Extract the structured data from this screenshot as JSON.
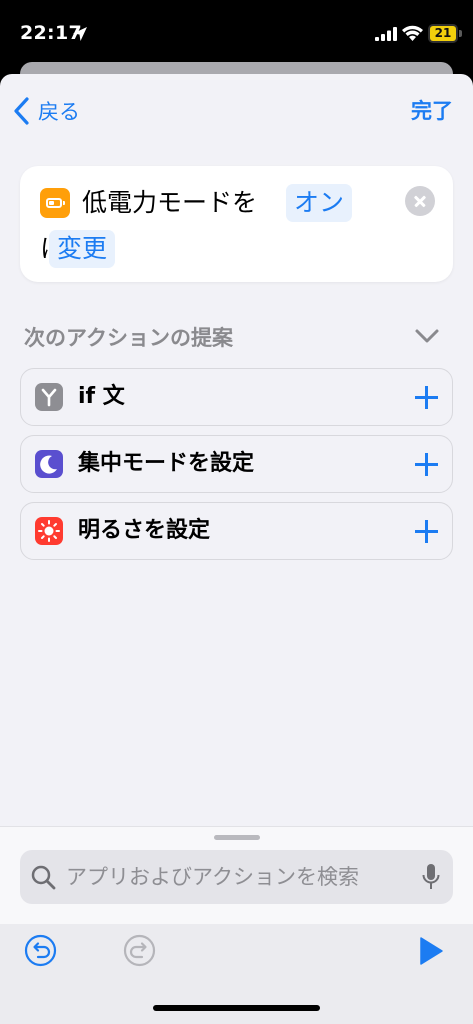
{
  "status_bar": {
    "time": "22:17",
    "battery_level": "21",
    "icons": [
      "location-arrow-icon",
      "cellular-signal-icon",
      "wifi-icon",
      "battery-icon"
    ]
  },
  "nav": {
    "back_label": "戻る",
    "done_label": "完了"
  },
  "action": {
    "icon": "battery-icon",
    "icon_color": "#ff9f0a",
    "title": "低電力モードを",
    "value_token": "オン",
    "connector": "に",
    "mode_token": "変更"
  },
  "suggestions": {
    "header": "次のアクションの提案",
    "items": [
      {
        "label": "if 文",
        "icon": "branch-icon",
        "icon_color": "#8e8e93"
      },
      {
        "label": "集中モードを設定",
        "icon": "moon-icon",
        "icon_color": "#5a4fcf"
      },
      {
        "label": "明るさを設定",
        "icon": "sun-icon",
        "icon_color": "#ff3b30"
      }
    ]
  },
  "search": {
    "placeholder": "アプリおよびアクションを検索"
  },
  "toolbar": {
    "icons": [
      "undo-icon",
      "redo-icon",
      "play-icon"
    ]
  },
  "colors": {
    "accent": "#1c7cf2",
    "background": "#f2f2f7"
  }
}
